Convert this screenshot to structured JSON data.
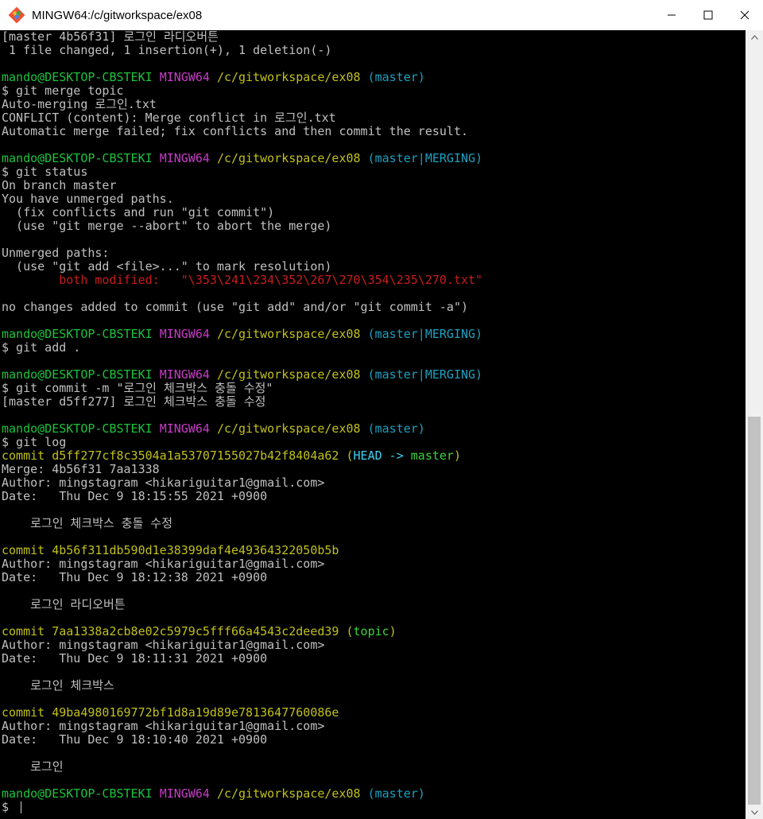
{
  "window": {
    "title": "MINGW64:/c/gitworkspace/ex08"
  },
  "colors": {
    "prompt_user": "#1cc33c",
    "prompt_system": "#c83bc8",
    "prompt_path": "#c0c01c",
    "prompt_branch": "#1ca0c0",
    "conflict_red": "#c81c1c",
    "default_text": "#c0c0c0"
  },
  "terminal": {
    "lines": [
      [
        {
          "t": "[master 4b56f31] 로그인 라디오버튼"
        }
      ],
      [
        {
          "t": " 1 file changed, 1 insertion(+), 1 deletion(-)"
        }
      ],
      [
        {
          "t": ""
        }
      ],
      [
        {
          "t": "mando@DESKTOP-CBSTEKI",
          "c": "green"
        },
        {
          "t": " "
        },
        {
          "t": "MINGW64",
          "c": "magenta"
        },
        {
          "t": " "
        },
        {
          "t": "/c/gitworkspace/ex08",
          "c": "yellow"
        },
        {
          "t": " "
        },
        {
          "t": "(master)",
          "c": "cyan"
        }
      ],
      [
        {
          "t": "$ git merge topic"
        }
      ],
      [
        {
          "t": "Auto-merging 로그인.txt"
        }
      ],
      [
        {
          "t": "CONFLICT (content): Merge conflict in 로그인.txt"
        }
      ],
      [
        {
          "t": "Automatic merge failed; fix conflicts and then commit the result."
        }
      ],
      [
        {
          "t": ""
        }
      ],
      [
        {
          "t": "mando@DESKTOP-CBSTEKI",
          "c": "green"
        },
        {
          "t": " "
        },
        {
          "t": "MINGW64",
          "c": "magenta"
        },
        {
          "t": " "
        },
        {
          "t": "/c/gitworkspace/ex08",
          "c": "yellow"
        },
        {
          "t": " "
        },
        {
          "t": "(master|MERGING)",
          "c": "cyan"
        }
      ],
      [
        {
          "t": "$ git status"
        }
      ],
      [
        {
          "t": "On branch master"
        }
      ],
      [
        {
          "t": "You have unmerged paths."
        }
      ],
      [
        {
          "t": "  (fix conflicts and run \"git commit\")"
        }
      ],
      [
        {
          "t": "  (use \"git merge --abort\" to abort the merge)"
        }
      ],
      [
        {
          "t": ""
        }
      ],
      [
        {
          "t": "Unmerged paths:"
        }
      ],
      [
        {
          "t": "  (use \"git add <file>...\" to mark resolution)"
        }
      ],
      [
        {
          "t": "        "
        },
        {
          "t": "both modified:   \"\\353\\241\\234\\352\\267\\270\\354\\235\\270.txt\"",
          "c": "red"
        }
      ],
      [
        {
          "t": ""
        }
      ],
      [
        {
          "t": "no changes added to commit (use \"git add\" and/or \"git commit -a\")"
        }
      ],
      [
        {
          "t": ""
        }
      ],
      [
        {
          "t": "mando@DESKTOP-CBSTEKI",
          "c": "green"
        },
        {
          "t": " "
        },
        {
          "t": "MINGW64",
          "c": "magenta"
        },
        {
          "t": " "
        },
        {
          "t": "/c/gitworkspace/ex08",
          "c": "yellow"
        },
        {
          "t": " "
        },
        {
          "t": "(master|MERGING)",
          "c": "cyan"
        }
      ],
      [
        {
          "t": "$ git add ."
        }
      ],
      [
        {
          "t": ""
        }
      ],
      [
        {
          "t": "mando@DESKTOP-CBSTEKI",
          "c": "green"
        },
        {
          "t": " "
        },
        {
          "t": "MINGW64",
          "c": "magenta"
        },
        {
          "t": " "
        },
        {
          "t": "/c/gitworkspace/ex08",
          "c": "yellow"
        },
        {
          "t": " "
        },
        {
          "t": "(master|MERGING)",
          "c": "cyan"
        }
      ],
      [
        {
          "t": "$ git commit -m \"로그인 체크박스 충돌 수정\""
        }
      ],
      [
        {
          "t": "[master d5ff277] 로그인 체크박스 충돌 수정"
        }
      ],
      [
        {
          "t": ""
        }
      ],
      [
        {
          "t": "mando@DESKTOP-CBSTEKI",
          "c": "green"
        },
        {
          "t": " "
        },
        {
          "t": "MINGW64",
          "c": "magenta"
        },
        {
          "t": " "
        },
        {
          "t": "/c/gitworkspace/ex08",
          "c": "yellow"
        },
        {
          "t": " "
        },
        {
          "t": "(master)",
          "c": "cyan"
        }
      ],
      [
        {
          "t": "$ git log"
        }
      ],
      [
        {
          "t": "commit d5ff277cf8c3504a1a53707155027b42f8404a62",
          "c": "yellow"
        },
        {
          "t": " "
        },
        {
          "t": "(",
          "c": "yellow"
        },
        {
          "t": "HEAD -> ",
          "c": "bcyan"
        },
        {
          "t": "master",
          "c": "bgreen"
        },
        {
          "t": ")",
          "c": "yellow"
        }
      ],
      [
        {
          "t": "Merge: 4b56f31 7aa1338"
        }
      ],
      [
        {
          "t": "Author: mingstagram <hikariguitar1@gmail.com>"
        }
      ],
      [
        {
          "t": "Date:   Thu Dec 9 18:15:55 2021 +0900"
        }
      ],
      [
        {
          "t": ""
        }
      ],
      [
        {
          "t": "    로그인 체크박스 충돌 수정"
        }
      ],
      [
        {
          "t": ""
        }
      ],
      [
        {
          "t": "commit 4b56f311db590d1e38399daf4e49364322050b5b",
          "c": "yellow"
        }
      ],
      [
        {
          "t": "Author: mingstagram <hikariguitar1@gmail.com>"
        }
      ],
      [
        {
          "t": "Date:   Thu Dec 9 18:12:38 2021 +0900"
        }
      ],
      [
        {
          "t": ""
        }
      ],
      [
        {
          "t": "    로그인 라디오버튼"
        }
      ],
      [
        {
          "t": ""
        }
      ],
      [
        {
          "t": "commit 7aa1338a2cb8e02c5979c5fff66a4543c2deed39",
          "c": "yellow"
        },
        {
          "t": " "
        },
        {
          "t": "(",
          "c": "yellow"
        },
        {
          "t": "topic",
          "c": "bgreen"
        },
        {
          "t": ")",
          "c": "yellow"
        }
      ],
      [
        {
          "t": "Author: mingstagram <hikariguitar1@gmail.com>"
        }
      ],
      [
        {
          "t": "Date:   Thu Dec 9 18:11:31 2021 +0900"
        }
      ],
      [
        {
          "t": ""
        }
      ],
      [
        {
          "t": "    로그인 체크박스"
        }
      ],
      [
        {
          "t": ""
        }
      ],
      [
        {
          "t": "commit 49ba4980169772bf1d8a19d89e7813647760086e",
          "c": "yellow"
        }
      ],
      [
        {
          "t": "Author: mingstagram <hikariguitar1@gmail.com>"
        }
      ],
      [
        {
          "t": "Date:   Thu Dec 9 18:10:40 2021 +0900"
        }
      ],
      [
        {
          "t": ""
        }
      ],
      [
        {
          "t": "    로그인"
        }
      ],
      [
        {
          "t": ""
        }
      ],
      [
        {
          "t": "mando@DESKTOP-CBSTEKI",
          "c": "green"
        },
        {
          "t": " "
        },
        {
          "t": "MINGW64",
          "c": "magenta"
        },
        {
          "t": " "
        },
        {
          "t": "/c/gitworkspace/ex08",
          "c": "yellow"
        },
        {
          "t": " "
        },
        {
          "t": "(master)",
          "c": "cyan"
        }
      ],
      [
        {
          "t": "$ "
        }
      ]
    ]
  }
}
